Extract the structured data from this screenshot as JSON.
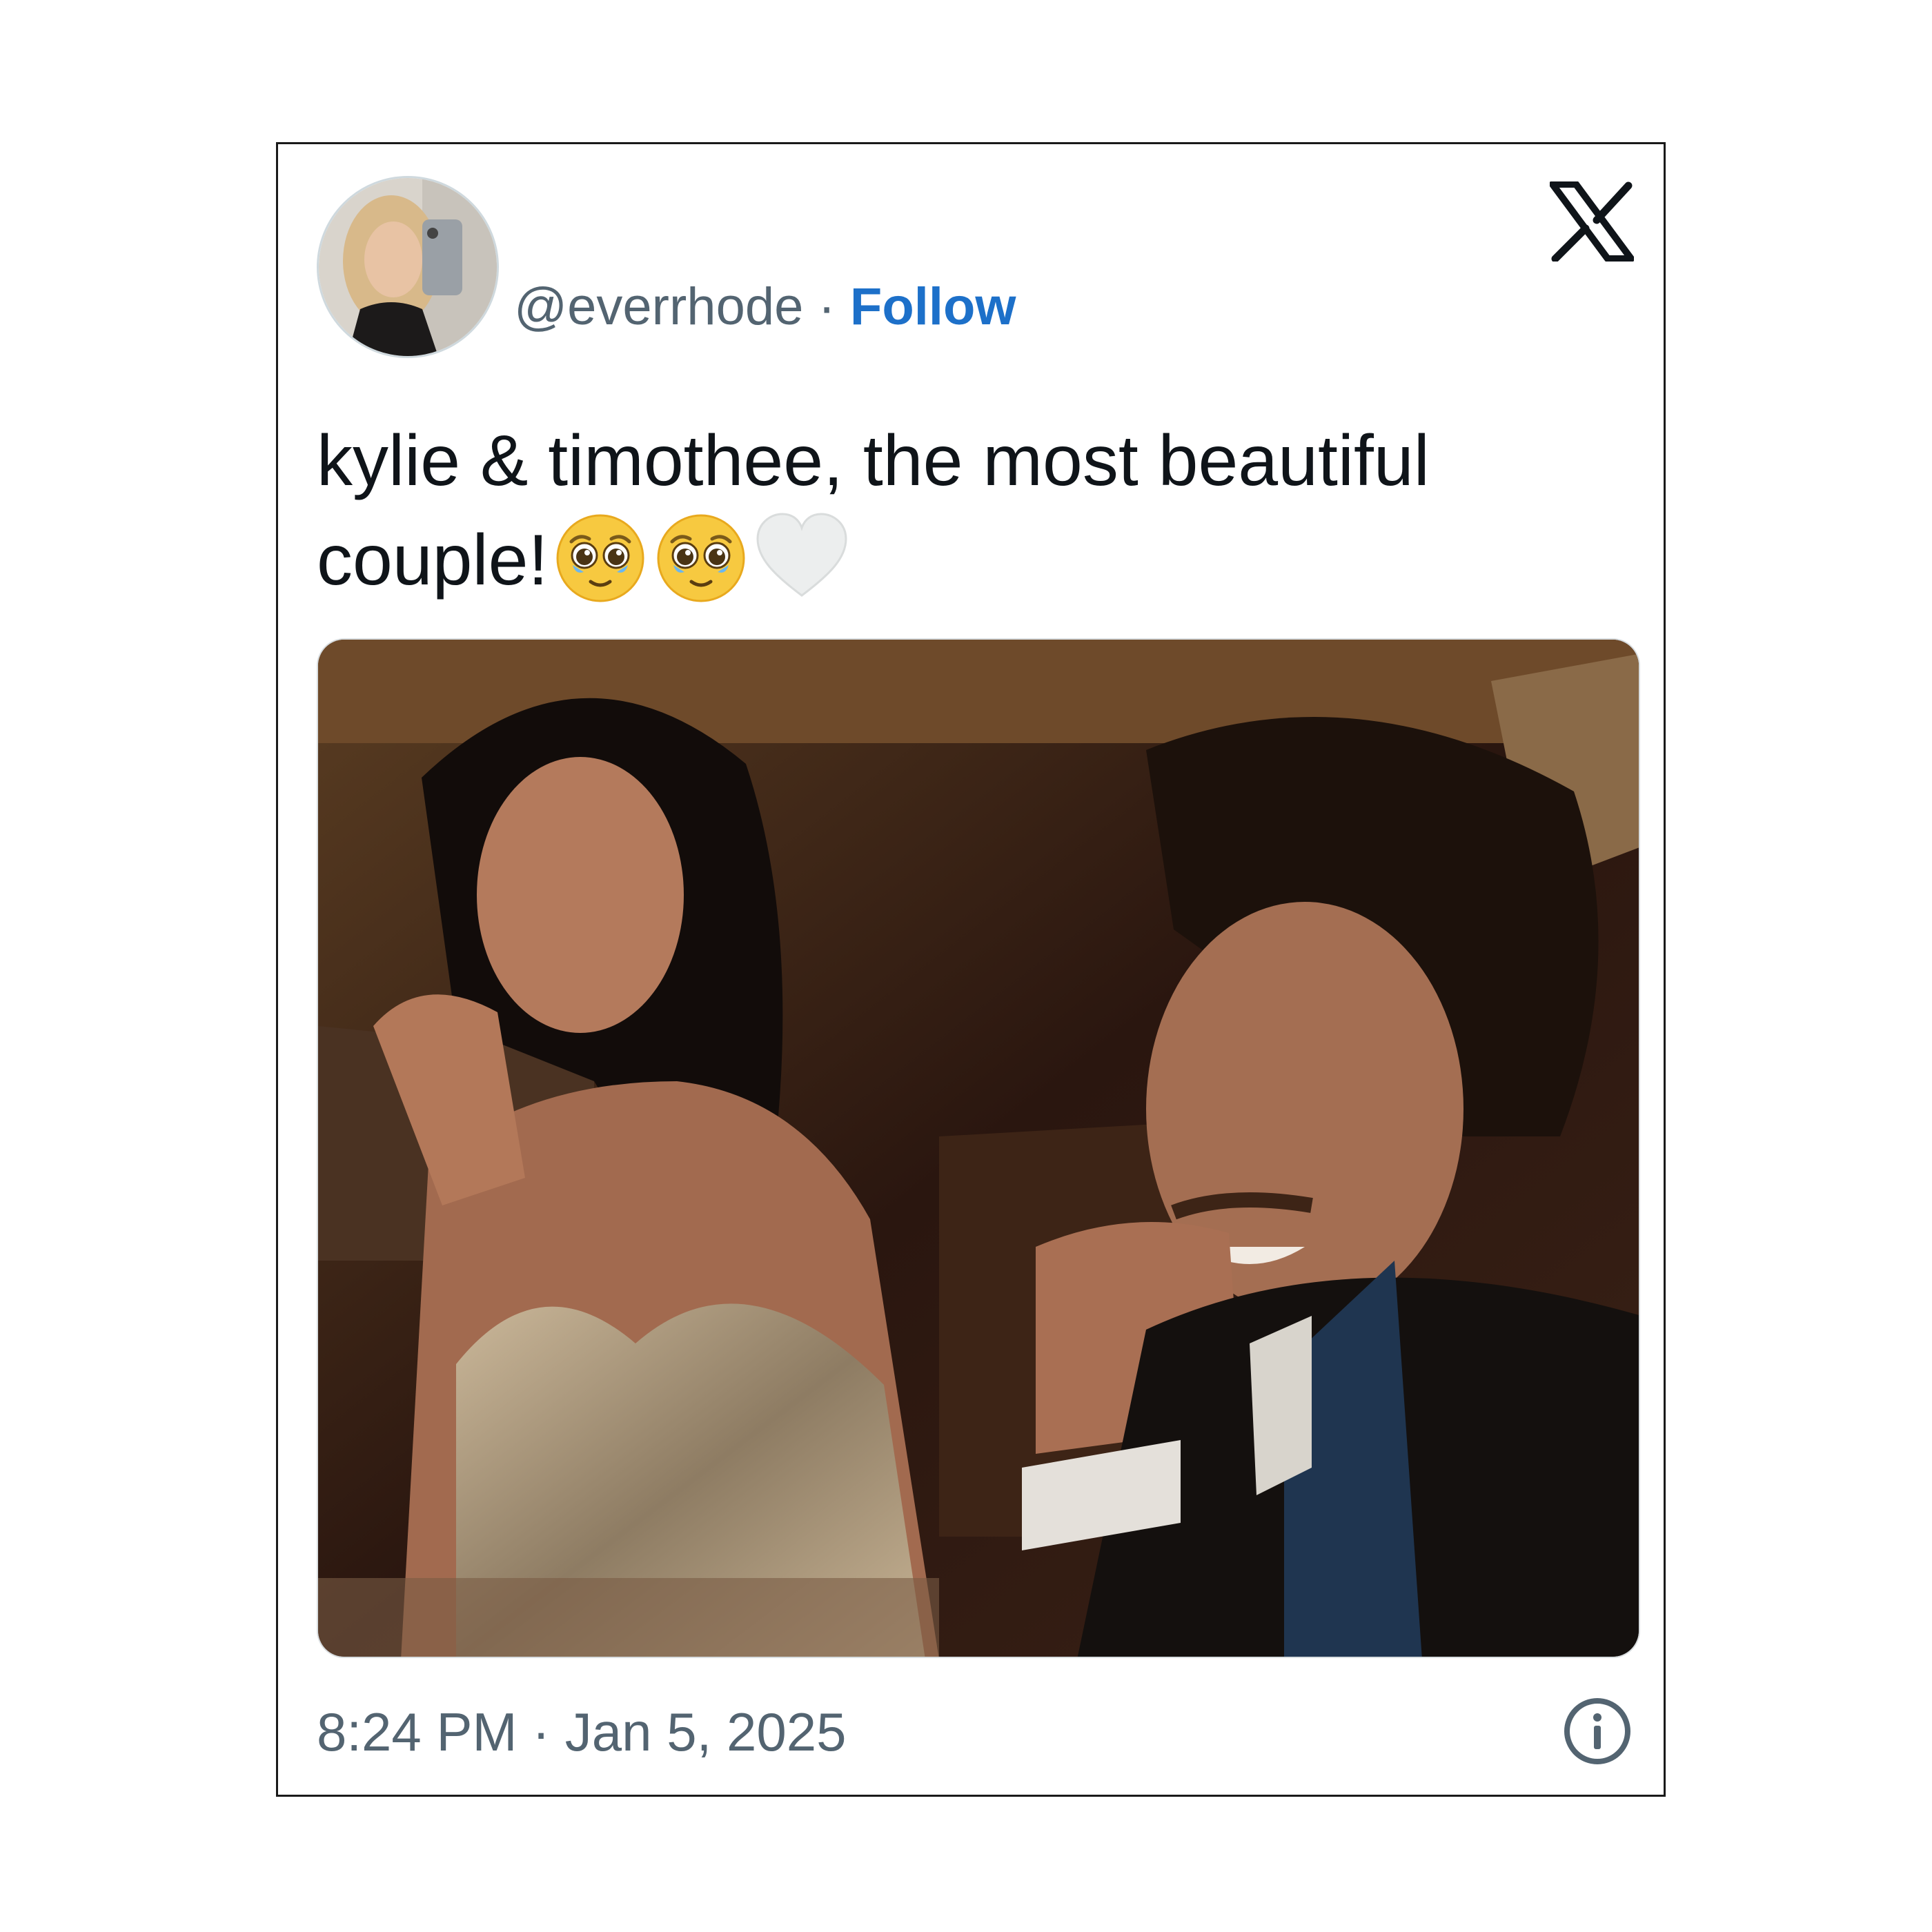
{
  "tweet": {
    "handle": "@everrhode",
    "separator": " · ",
    "follow_label": "Follow",
    "text": "kylie & timothee, the most beautiful couple!",
    "emojis": [
      "pleading-face-emoji",
      "pleading-face-emoji",
      "white-heart-emoji"
    ],
    "timestamp": "8:24 PM · Jan 5, 2025",
    "platform_icon": "x-logo-icon",
    "info_icon": "info-icon"
  },
  "colors": {
    "follow": "#1d70c9",
    "secondary_text": "#536471",
    "primary_text": "#0f1419",
    "card_border": "#1a1a1a"
  }
}
